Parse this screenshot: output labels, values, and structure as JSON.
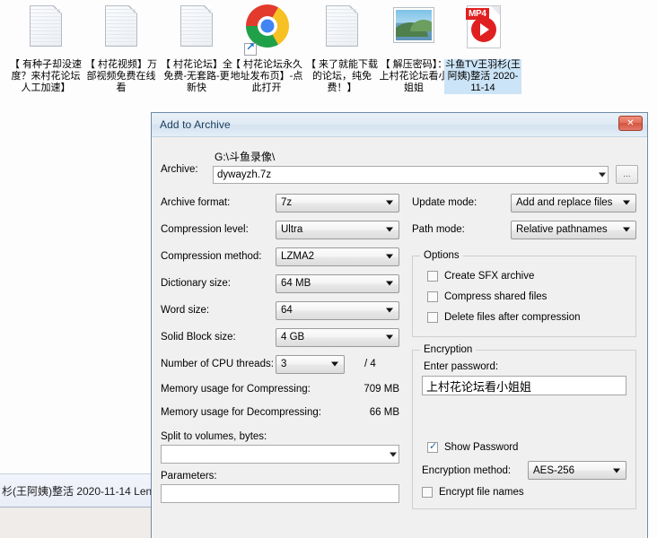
{
  "desktop": {
    "icons": [
      {
        "name": "icon-doc-1",
        "type": "document",
        "label": "【 有种子却没速度？来村花论坛人工加速】",
        "selected": false
      },
      {
        "name": "icon-doc-2",
        "type": "document",
        "label": "【 村花视频】万部视频免费在线看",
        "selected": false
      },
      {
        "name": "icon-doc-3",
        "type": "document",
        "label": "【 村花论坛】全免费-无套路-更新快",
        "selected": false
      },
      {
        "name": "icon-chrome-shortcut",
        "type": "chrome-shortcut",
        "label": "【 村花论坛永久地址发布页】-点此打开",
        "selected": false
      },
      {
        "name": "icon-doc-4",
        "type": "document",
        "label": "【 来了就能下载的论坛，纯免费！】",
        "selected": false
      },
      {
        "name": "icon-image",
        "type": "image",
        "label": "【 解压密码】：上村花论坛看小姐姐",
        "selected": false
      },
      {
        "name": "icon-mp4",
        "type": "mp4",
        "label": "斗鱼TV王羽杉(王阿姨)整活 2020-11-14",
        "badge": "MP4",
        "selected": true
      }
    ]
  },
  "taskbar": {
    "item_label": "杉(王阿姨)整活 2020-11-14 Len"
  },
  "dialog": {
    "title": "Add to Archive",
    "close_label": "Close",
    "archive": {
      "label": "Archive:",
      "path": "G:\\斗鱼录像\\",
      "filename": "dywayzh.7z",
      "browse_label": "..."
    },
    "left": {
      "archive_format": {
        "label": "Archive format:",
        "value": "7z"
      },
      "compression_level": {
        "label": "Compression level:",
        "value": "Ultra"
      },
      "compression_method": {
        "label": "Compression method:",
        "value": "LZMA2"
      },
      "dictionary_size": {
        "label": "Dictionary size:",
        "value": "64 MB"
      },
      "word_size": {
        "label": "Word size:",
        "value": "64"
      },
      "solid_block_size": {
        "label": "Solid Block size:",
        "value": "4 GB"
      },
      "cpu_threads": {
        "label": "Number of CPU threads:",
        "value": "3",
        "suffix": "/ 4"
      },
      "mem_compress": {
        "label": "Memory usage for Compressing:",
        "value": "709 MB"
      },
      "mem_decompress": {
        "label": "Memory usage for Decompressing:",
        "value": "66 MB"
      },
      "split_volumes": {
        "label": "Split to volumes, bytes:",
        "value": ""
      },
      "parameters": {
        "label": "Parameters:",
        "value": ""
      }
    },
    "right": {
      "update_mode": {
        "label": "Update mode:",
        "value": "Add and replace files"
      },
      "path_mode": {
        "label": "Path mode:",
        "value": "Relative pathnames"
      },
      "options": {
        "legend": "Options",
        "items": [
          {
            "label": "Create SFX archive",
            "checked": false
          },
          {
            "label": "Compress shared files",
            "checked": false
          },
          {
            "label": "Delete files after compression",
            "checked": false
          }
        ]
      },
      "encryption": {
        "legend": "Encryption",
        "password_label": "Enter password:",
        "password_value": "上村花论坛看小姐姐",
        "show_password": {
          "label": "Show Password",
          "checked": true
        },
        "method": {
          "label": "Encryption method:",
          "value": "AES-256"
        },
        "encrypt_file_names": {
          "label": "Encrypt file names",
          "checked": false
        }
      }
    }
  },
  "colors": {
    "dialog_bg": "#f0f0f0",
    "titlebar": "#dfeaf4",
    "close_red": "#d4543f",
    "desktop_bg": "#fdfdfd",
    "mp4_red": "#e02020",
    "selection": "#cce4f7"
  }
}
